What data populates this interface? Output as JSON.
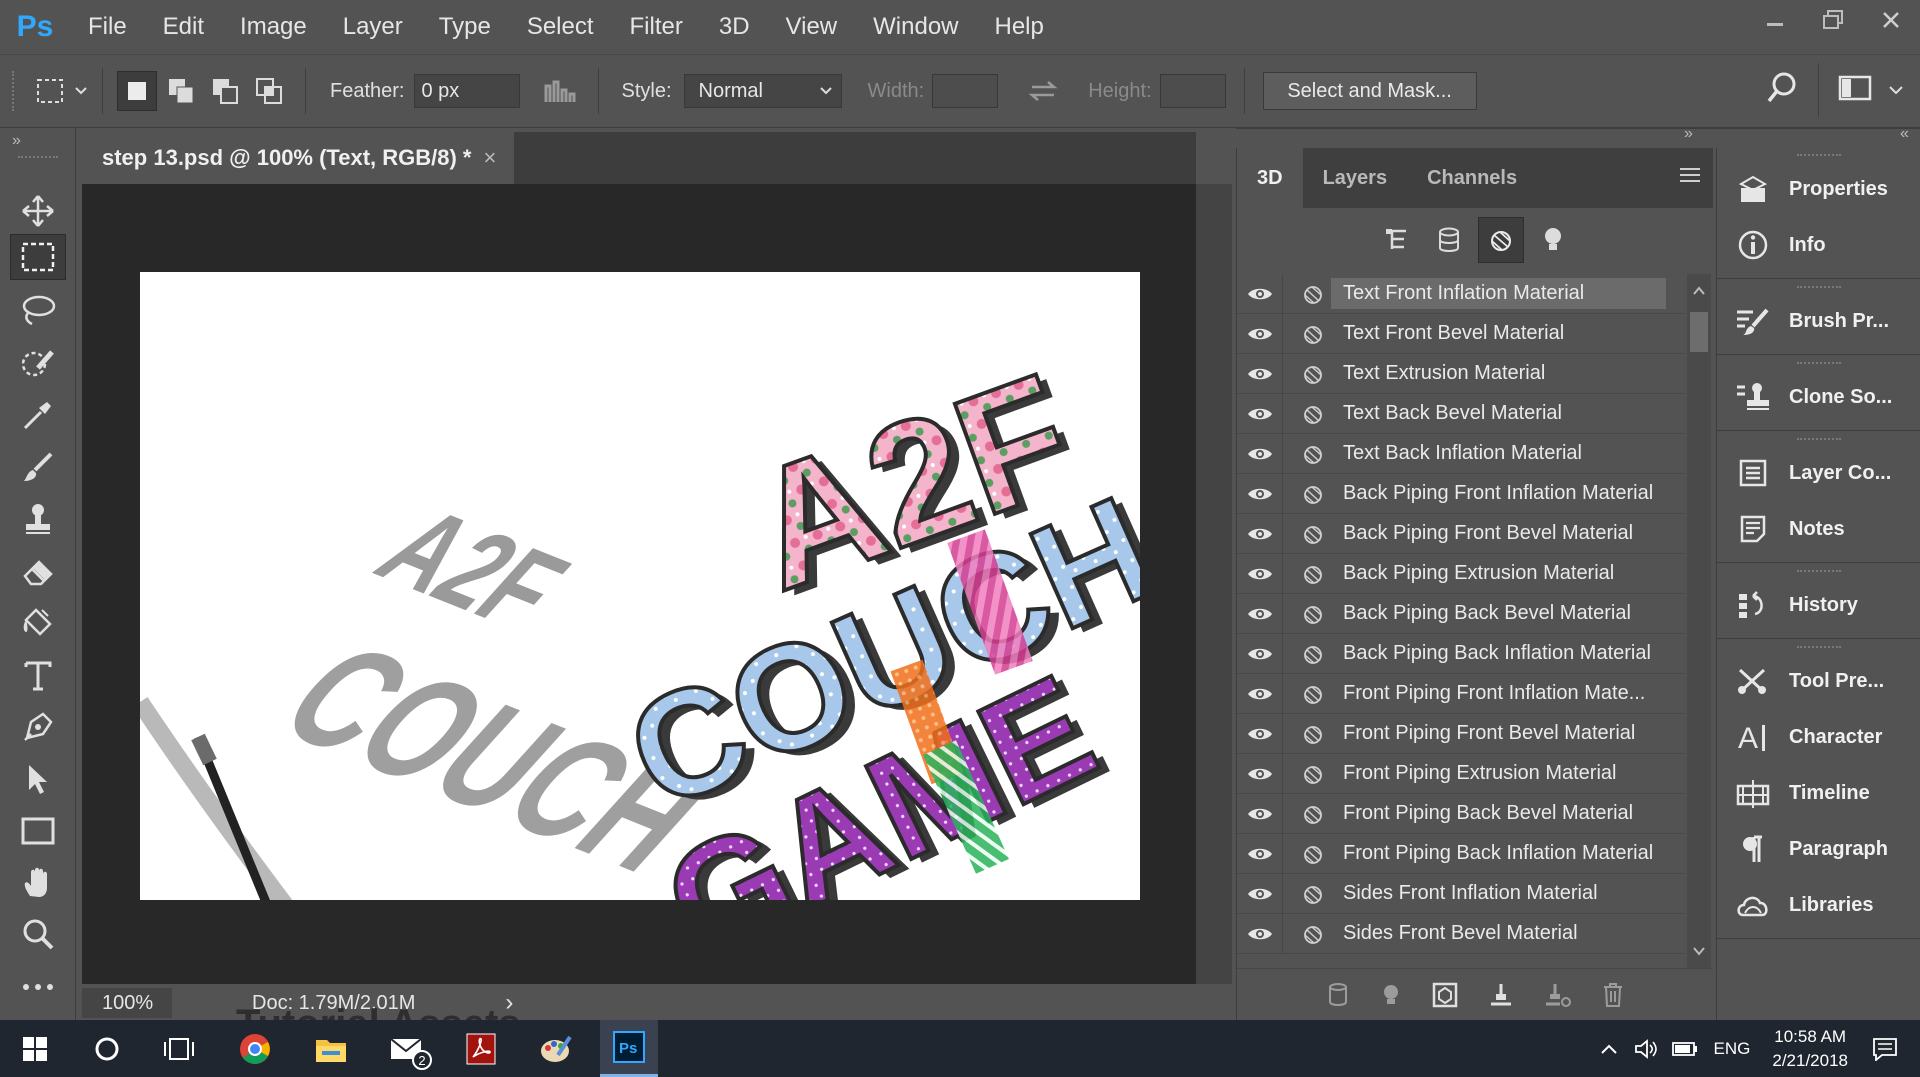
{
  "app": {
    "logo": "Ps"
  },
  "menu": [
    "File",
    "Edit",
    "Image",
    "Layer",
    "Type",
    "Select",
    "Filter",
    "3D",
    "View",
    "Window",
    "Help"
  ],
  "window_controls": [
    "minimize-icon",
    "restore-icon",
    "close-icon"
  ],
  "options": {
    "feather_label": "Feather:",
    "feather_value": "0 px",
    "style_label": "Style:",
    "style_value": "Normal",
    "width_label": "Width:",
    "height_label": "Height:",
    "select_mask_label": "Select and Mask..."
  },
  "document": {
    "tab_title": "step 13.psd @ 100% (Text, RGB/8) *",
    "tab_close": "×",
    "zoom": "100%",
    "doc_info": "Doc: 1.79M/2.01M",
    "status_arrow": "›",
    "artwork_lines": [
      "A2F",
      "COUCH",
      "GAME"
    ]
  },
  "panel3d": {
    "tabs": [
      "3D",
      "Layers",
      "Channels"
    ],
    "active_tab": "3D",
    "materials": [
      "Text Front Inflation Material",
      "Text Front Bevel Material",
      "Text Extrusion Material",
      "Text Back Bevel Material",
      "Text Back Inflation Material",
      "Back Piping Front Inflation Material",
      "Back Piping Front Bevel Material",
      "Back Piping Extrusion Material",
      "Back Piping Back Bevel Material",
      "Back Piping Back Inflation Material",
      "Front Piping Front Inflation Mate...",
      "Front Piping Front Bevel Material",
      "Front Piping Extrusion Material",
      "Front Piping Back Bevel Material",
      "Front Piping Back Inflation Material",
      "Sides Front Inflation Material",
      "Sides Front Bevel Material"
    ],
    "selected_material": "Text Front Inflation Material"
  },
  "dock": {
    "groups": [
      [
        {
          "label": "Properties",
          "icon": "properties-icon"
        },
        {
          "label": "Info",
          "icon": "info-icon"
        }
      ],
      [
        {
          "label": "Brush Pr...",
          "icon": "brush-presets-icon"
        }
      ],
      [
        {
          "label": "Clone So...",
          "icon": "clone-source-icon"
        }
      ],
      [
        {
          "label": "Layer Co...",
          "icon": "layer-comps-icon"
        },
        {
          "label": "Notes",
          "icon": "notes-icon"
        }
      ],
      [
        {
          "label": "History",
          "icon": "history-icon"
        }
      ],
      [
        {
          "label": "Tool Pre...",
          "icon": "tool-presets-icon"
        },
        {
          "label": "Character",
          "icon": "character-icon"
        },
        {
          "label": "Timeline",
          "icon": "timeline-icon"
        },
        {
          "label": "Paragraph",
          "icon": "paragraph-icon"
        },
        {
          "label": "Libraries",
          "icon": "libraries-icon"
        }
      ]
    ]
  },
  "taskbar": {
    "mail_badge": "2",
    "language": "ENG",
    "time": "10:58 AM",
    "date": "2/21/2018",
    "overlay_text": "Tutorial Assets"
  },
  "colors": {
    "ps_blue": "#31a8ff",
    "panel_bg": "#535353",
    "canvas_bg": "#282828"
  }
}
